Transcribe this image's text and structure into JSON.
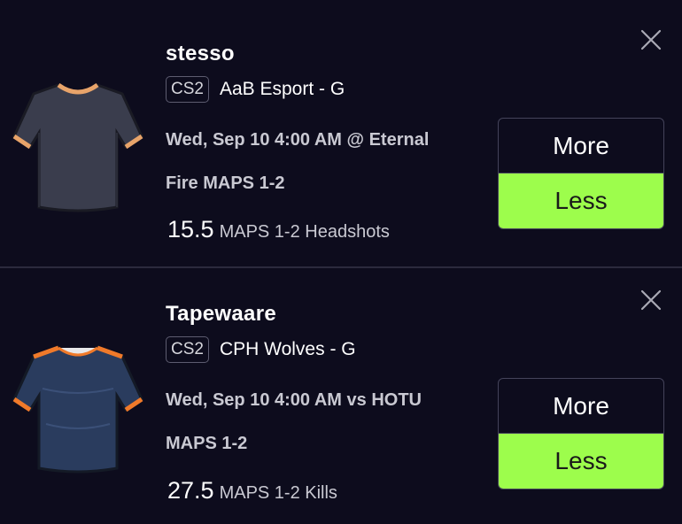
{
  "picks": [
    {
      "player": "stesso",
      "game": "CS2",
      "team": "AaB Esport - G",
      "match_line_1": "Wed, Sep 10 4:00 AM @ Eternal",
      "match_line_2": "Fire MAPS 1-2",
      "stat_value": "15.5",
      "stat_label": "MAPS 1-2 Headshots",
      "more_label": "More",
      "less_label": "Less",
      "selected": "Less",
      "jersey_colors": {
        "body": "#3a3d4d",
        "trim": "#e8a46a"
      },
      "close_icon": "close-icon"
    },
    {
      "player": "Tapewaare",
      "game": "CS2",
      "team": "CPH Wolves - G",
      "match_line_1": "Wed, Sep 10 4:00 AM vs HOTU",
      "match_line_2": "MAPS 1-2",
      "stat_value": "27.5",
      "stat_label": "MAPS 1-2 Kills",
      "more_label": "More",
      "less_label": "Less",
      "selected": "Less",
      "jersey_colors": {
        "body": "#2a3c5e",
        "trim": "#f07a2a"
      },
      "close_icon": "close-icon"
    }
  ],
  "colors": {
    "background": "#0d0c1d",
    "selected_accent": "#9dfd4c",
    "divider": "#2b2a3d"
  }
}
